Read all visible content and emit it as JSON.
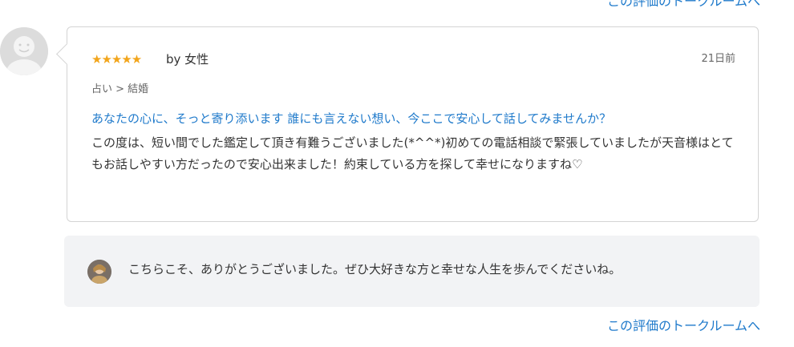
{
  "links": {
    "top_talkroom": "この評価のトークルームへ",
    "bottom_talkroom": "この評価のトークルームへ"
  },
  "review": {
    "rating": 5,
    "stars": "★★★★★",
    "by_label": "by 女性",
    "date": "21日前",
    "category": "占い > 結婚",
    "title": "あなたの心に、そっと寄り添います 誰にも言えない想い、今ここで安心して話してみませんか？",
    "body": "この度は、短い間でした鑑定して頂き有難うございました(*^^*)初めての電話相談で緊張していましたが天音様はとてもお話しやすい方だったので安心出来ました！約束している方を探して幸せになりますね♡"
  },
  "reply": {
    "text": "こちらこそ、ありがとうございました。ぜひ大好きな方と幸せな人生を歩んでくださいね。"
  },
  "colors": {
    "link": "#1f7acb",
    "star": "#f2a51b",
    "reply_bg": "#f2f3f5",
    "border": "#d4d4d4"
  },
  "icons": {
    "reviewer_avatar": "default-user-avatar-icon",
    "reply_avatar": "seller-avatar-icon"
  }
}
